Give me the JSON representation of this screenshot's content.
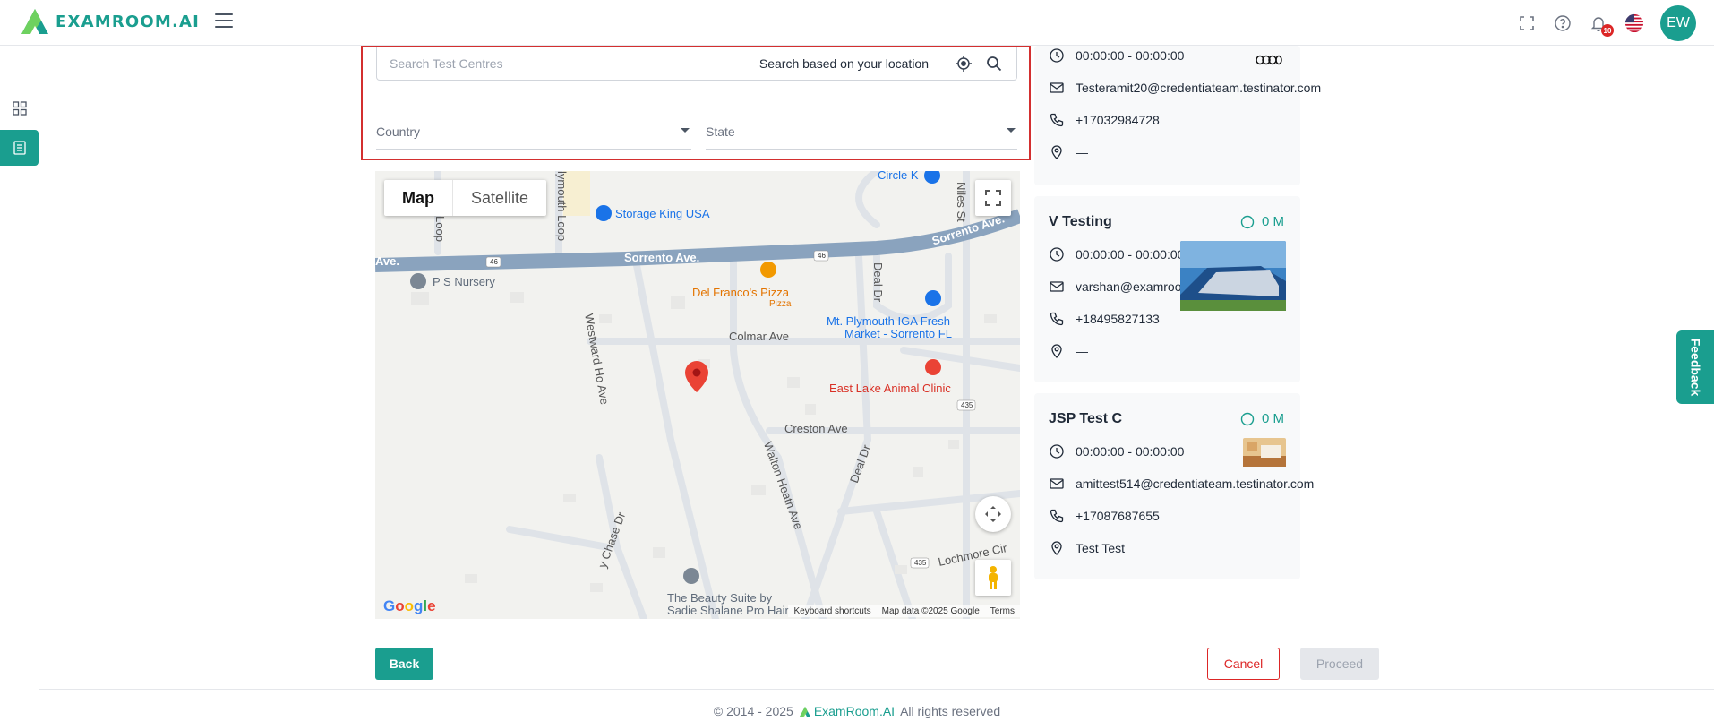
{
  "header": {
    "logo_text": "EXAMROOM.AI",
    "notifications_count": "10",
    "avatar_initials": "EW"
  },
  "search": {
    "placeholder": "Search Test Centres",
    "location_label": "Search based on your location",
    "country_label": "Country",
    "state_label": "State"
  },
  "map": {
    "toggle_map": "Map",
    "toggle_satellite": "Satellite",
    "labels": {
      "storage_king": "Storage King USA",
      "circle_k": "Circle K",
      "sorrento_ave_1": "Sorrento Ave.",
      "sorrento_ave_2": "Sorrento Ave.",
      "ave_left": "Ave.",
      "ps_nursery": "P S Nursery",
      "del_francos": "Del Franco's Pizza",
      "pizza": "Pizza",
      "mt_plymouth_1": "Mt. Plymouth IGA Fresh",
      "mt_plymouth_2": "Market - Sorrento FL",
      "colmar_ave": "Colmar Ave",
      "east_lake": "East Lake Animal Clinic",
      "creston_ave": "Creston Ave",
      "westward_ho": "Westward Ho Ave",
      "walton_heath": "Walton Heath Ave",
      "deal_dr_1": "Deal Dr",
      "deal_dr_2": "Deal Dr",
      "niles_st": "Niles St",
      "plymouth_loop": "lymouth Loop",
      "loop": "Loop",
      "lochmore": "Lochmore Cir",
      "chase_dr": "y Chase Dr",
      "beauty_1": "The Beauty Suite by",
      "beauty_2": "Sadie Shalane Pro Hair",
      "route_46_a": "46",
      "route_46_b": "46",
      "route_435_a": "435",
      "route_435_b": "435"
    },
    "google": "Google",
    "attribution": {
      "shortcuts": "Keyboard shortcuts",
      "data": "Map data ©2025 Google",
      "terms": "Terms"
    }
  },
  "cards": [
    {
      "name": "",
      "time": "00:00:00 - 00:00:00",
      "email": "Testeramit20@credentiateam.testinator.com",
      "phone": "+17032984728",
      "address": "—"
    },
    {
      "name": "V Testing",
      "distance": "0 M",
      "time": "00:00:00 - 00:00:00",
      "email": "varshan@examroom.ai",
      "phone": "+18495827133",
      "address": "—"
    },
    {
      "name": "JSP Test C",
      "distance": "0 M",
      "time": "00:00:00 - 00:00:00",
      "email": "amittest514@credentiateam.testinator.com",
      "phone": "+17087687655",
      "address": "Test Test"
    }
  ],
  "feedback_label": "Feedback",
  "buttons": {
    "back": "Back",
    "cancel": "Cancel",
    "proceed": "Proceed"
  },
  "footer": {
    "copyright": "© 2014 - 2025",
    "brand": "ExamRoom.AI",
    "rights": "All rights reserved"
  },
  "colors": {
    "brand": "#1a9e8f",
    "highlight_border": "#d32f2f",
    "danger": "#dc2626"
  }
}
